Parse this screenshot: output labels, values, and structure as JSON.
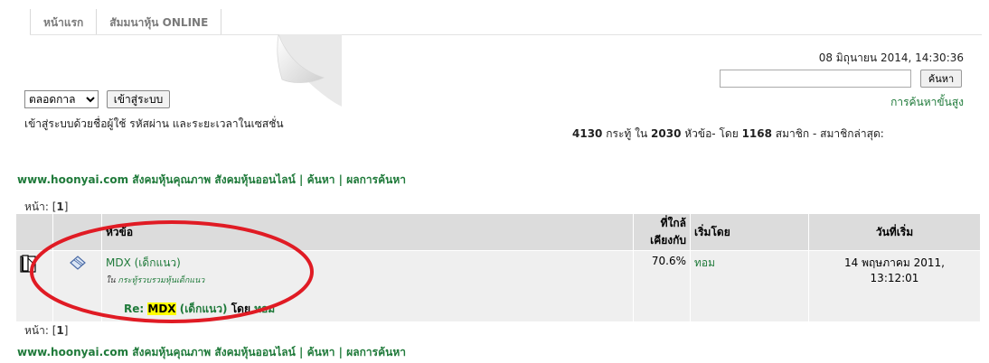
{
  "tabs": [
    "หน้าแรก",
    "สัมมนาหุ้น ONLINE"
  ],
  "datetime": "08 มิถุนายน 2014, 14:30:36",
  "search": {
    "value": "",
    "button": "ค้นหา",
    "advanced": "การค้นหาขั้นสูง"
  },
  "login": {
    "duration": "ตลอดกาล",
    "button": "เข้าสู่ระบบ",
    "note": "เข้าสู่ระบบด้วยชื่อผู้ใช้ รหัสผ่าน และระยะเวลาในเซสชั่น"
  },
  "stats": {
    "posts": "4130",
    "posts_label": "กระทู้ ใน",
    "topics": "2030",
    "topics_label": "หัวข้อ- โดย",
    "members": "1168",
    "members_label": "สมาชิก - สมาชิกล่าสุด:"
  },
  "site_links": {
    "home": "www.hoonyai.com สังคมหุ้นคุณภาพ สังคมหุ้นออนไลน์",
    "sep": "|",
    "search": "ค้นหา",
    "results": "ผลการค้นหา"
  },
  "pagination": {
    "label": "หน้า:",
    "current": "1"
  },
  "table": {
    "headers": {
      "topic": "หัวข้อ",
      "relevance_1": "ที่ใกล้",
      "relevance_2": "เคียงกับ",
      "started_by": "เริ่มโดย",
      "start_date": "วันที่เริ่ม"
    },
    "rows": [
      {
        "topic": "MDX (เด็กแนว)",
        "in_label": "ใน",
        "board": "กระทู้รวบรวมหุ้นเด็กแนว",
        "reply_prefix": "Re:",
        "reply_highlight": "MDX",
        "reply_rest": "(เด็กแนว)",
        "reply_by": "โดย",
        "reply_author": "ทอม",
        "relevance": "70.6%",
        "started_by": "ทอม",
        "date_1": "14 พฤษภาคม 2011,",
        "date_2": "13:12:01"
      }
    ]
  },
  "colors": {
    "link": "#1f7a3a",
    "highlight": "#ffff00",
    "annotation": "#e01b24"
  }
}
